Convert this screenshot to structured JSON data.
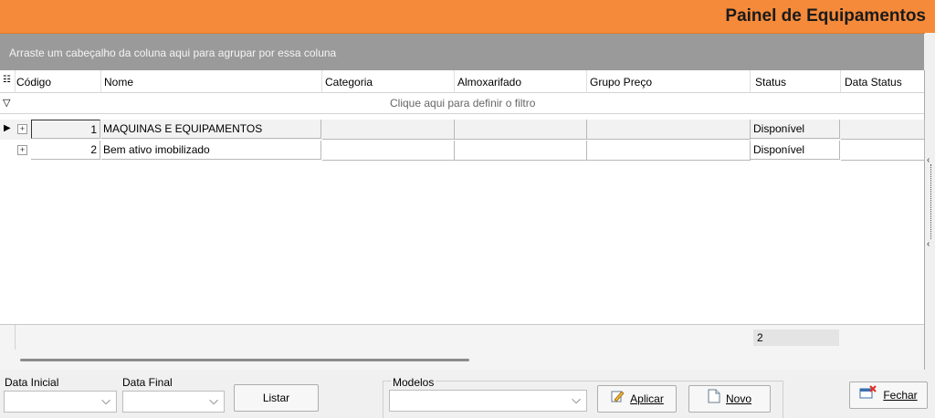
{
  "window": {
    "title": "Painel de Equipamentos"
  },
  "grid": {
    "group_hint": "Arraste um cabeçalho da coluna aqui para agrupar por essa coluna",
    "filter_hint": "Clique aqui para definir o filtro",
    "columns": [
      "Código",
      "Nome",
      "Categoria",
      "Almoxarifado",
      "Grupo Preço",
      "Status",
      "Data Status"
    ],
    "rows": [
      {
        "codigo": "1",
        "nome": "MAQUINAS E EQUIPAMENTOS",
        "categoria": "",
        "almoxarifado": "",
        "grupo_preco": "",
        "status": "Disponível",
        "data_status": ""
      },
      {
        "codigo": "2",
        "nome": "Bem ativo imobilizado",
        "categoria": "",
        "almoxarifado": "",
        "grupo_preco": "",
        "status": "Disponível",
        "data_status": ""
      }
    ],
    "footer_count": "2"
  },
  "filters": {
    "data_inicial_label": "Data Inicial",
    "data_final_label": "Data Final",
    "listar_label": "Listar",
    "modelos_label": "Modelos",
    "aplicar_label": "Aplicar",
    "novo_label": "Novo",
    "fechar_label": "Fechar"
  },
  "icons": [
    "column-chooser-icon",
    "filter-icon",
    "expand-icon",
    "row-indicator-icon",
    "chevron-down-icon",
    "edit-icon",
    "new-document-icon",
    "close-window-icon"
  ]
}
